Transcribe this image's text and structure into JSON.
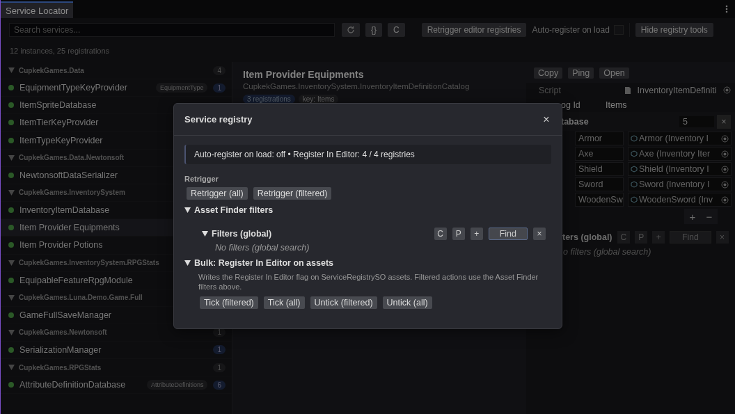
{
  "tab": {
    "label": "Service Locator",
    "selected": true
  },
  "toolbar": {
    "search": {
      "placeholder": "Search services..."
    },
    "code_button": "{}",
    "clear_button": "C",
    "retrigger_button": "Retrigger editor registries",
    "auto_register": {
      "label": "Auto-register on load",
      "checked": false
    },
    "hide_button": "Hide registry tools"
  },
  "status": "12 instances, 25 registrations",
  "sidebar": {
    "groups": [
      {
        "name": "CupkekGames.Data",
        "count": "4",
        "expanded": true,
        "items": [
          {
            "name": "EquipmentTypeKeyProvider",
            "badge": "EquipmentType",
            "count": "1",
            "selected": false
          },
          {
            "name": "ItemSpriteDatabase",
            "selected": false
          },
          {
            "name": "ItemTierKeyProvider",
            "selected": false
          },
          {
            "name": "ItemTypeKeyProvider",
            "selected": false
          }
        ]
      },
      {
        "name": "CupkekGames.Data.Newtonsoft",
        "expanded": true,
        "items": [
          {
            "name": "NewtonsoftDataSerializer",
            "selected": false
          }
        ]
      },
      {
        "name": "CupkekGames.InventorySystem",
        "expanded": true,
        "items": [
          {
            "name": "InventoryItemDatabase",
            "selected": false
          },
          {
            "name": "Item Provider Equipments",
            "selected": true
          },
          {
            "name": "Item Provider Potions",
            "selected": false
          }
        ]
      },
      {
        "name": "CupkekGames.InventorySystem.RPGStats",
        "expanded": true,
        "items": [
          {
            "name": "EquipableFeatureRpgModule",
            "selected": false
          }
        ]
      },
      {
        "name": "CupkekGames.Luna.Demo.Game.Full",
        "expanded": true,
        "items": [
          {
            "name": "GameFullSaveManager",
            "selected": false
          }
        ]
      },
      {
        "name": "CupkekGames.Newtonsoft",
        "count": "1",
        "expanded": true,
        "items": [
          {
            "name": "SerializationManager",
            "count": "1",
            "selected": false
          }
        ]
      },
      {
        "name": "CupkekGames.RPGStats",
        "count": "1",
        "expanded": true,
        "items": [
          {
            "name": "AttributeDefinitionDatabase",
            "badge": "AttributeDefinitions",
            "count": "6",
            "selected": false
          }
        ]
      }
    ]
  },
  "detail": {
    "title": "Item Provider Equipments",
    "subtitle": "CupkekGames.InventorySystem.InventoryItemDefinitionCatalog",
    "tags": [
      "3 registrations",
      "key: Items"
    ]
  },
  "inspector": {
    "buttons": [
      "Copy",
      "Ping",
      "Open"
    ],
    "script": {
      "label": "Script",
      "value": "InventoryItemDefiniti"
    },
    "catalog": {
      "label": "og Id",
      "value": "Items"
    },
    "database": {
      "label": "tabase",
      "size": "5",
      "remove": "×"
    },
    "entries": [
      {
        "key": "Armor",
        "value": "Armor (Inventory I"
      },
      {
        "key": "Axe",
        "value": "Axe (Inventory Iter"
      },
      {
        "key": "Shield",
        "value": "Shield (Inventory I"
      },
      {
        "key": "Sword",
        "value": "Sword (Inventory I"
      },
      {
        "key": "WoodenSw",
        "value": "WoodenSword (Inv"
      }
    ],
    "add": "+",
    "minus": "−",
    "filters": {
      "label": "ters (global)",
      "buttons": [
        "C",
        "P",
        "+",
        "Find",
        "×"
      ],
      "empty": "o filters (global search)"
    }
  },
  "modal": {
    "title": "Service registry",
    "close": "×",
    "info": "Auto-register on load: off • Register In Editor: 4 / 4 registries",
    "retrigger": {
      "label": "Retrigger",
      "buttons": [
        "Retrigger (all)",
        "Retrigger (filtered)"
      ]
    },
    "finder": {
      "title": "Asset Finder filters",
      "expanded": true,
      "filters": {
        "title": "Filters (global)",
        "expanded": true,
        "buttons": [
          "C",
          "P",
          "+",
          "Find",
          "×"
        ],
        "empty": "No filters (global search)"
      }
    },
    "bulk": {
      "title": "Bulk: Register In Editor on assets",
      "expanded": true,
      "description": "Writes the Register In Editor flag on ServiceRegistrySO assets. Filtered actions use the Asset Finder filters above.",
      "buttons": [
        "Tick (filtered)",
        "Tick (all)",
        "Untick (filtered)",
        "Untick (all)"
      ]
    }
  }
}
